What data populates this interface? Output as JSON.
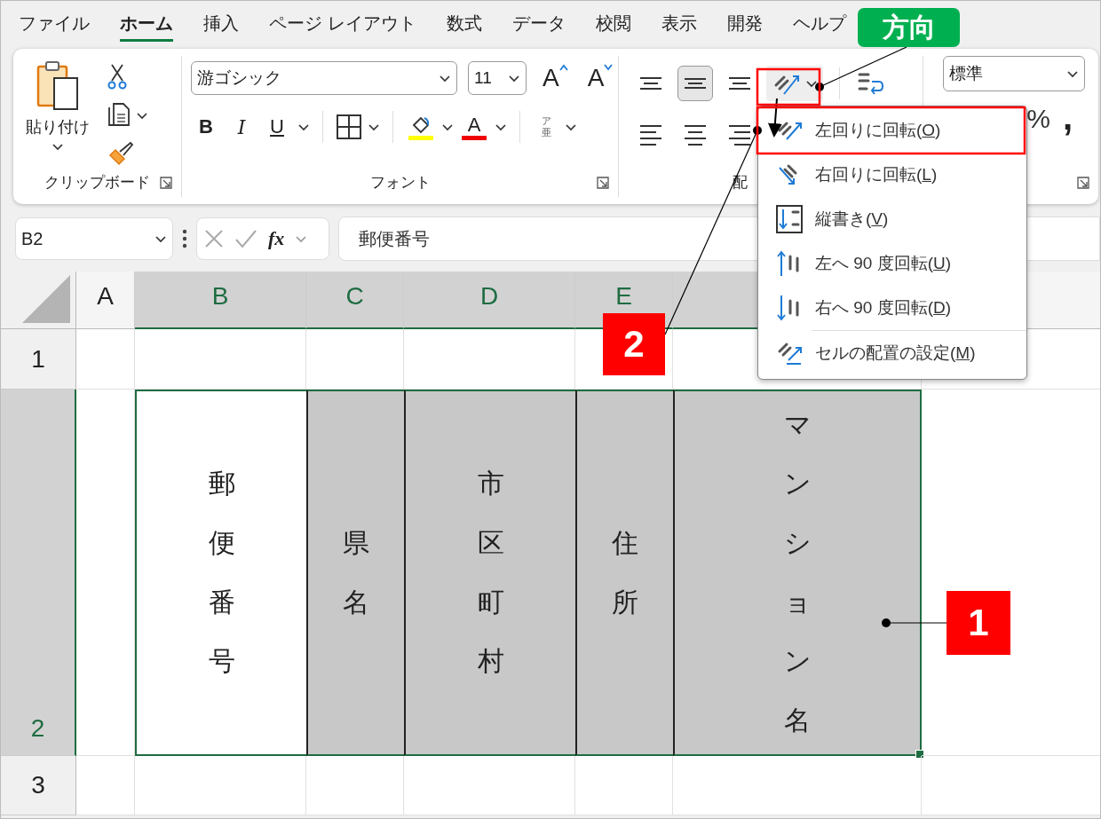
{
  "menu_tabs": [
    {
      "label": "ファイル",
      "selected": false
    },
    {
      "label": "ホーム",
      "selected": true
    },
    {
      "label": "挿入",
      "selected": false
    },
    {
      "label": "ページ レイアウト",
      "selected": false
    },
    {
      "label": "数式",
      "selected": false
    },
    {
      "label": "データ",
      "selected": false
    },
    {
      "label": "校閲",
      "selected": false
    },
    {
      "label": "表示",
      "selected": false
    },
    {
      "label": "開発",
      "selected": false
    },
    {
      "label": "ヘルプ",
      "selected": false
    }
  ],
  "ribbon": {
    "clipboard": {
      "paste": "貼り付け",
      "label": "クリップボード"
    },
    "font": {
      "font_name": "游ゴシック",
      "font_size": "11",
      "grow": "A",
      "shrink": "A",
      "bold": "B",
      "italic": "I",
      "underline": "U",
      "font_color": "A",
      "phonetic_top": "ア",
      "phonetic_bottom": "亜",
      "label": "フォント"
    },
    "alignment": {
      "buttons": [
        {
          "kind": "top",
          "selected": false
        },
        {
          "kind": "middle",
          "selected": true
        },
        {
          "kind": "bottom",
          "selected": false
        },
        {
          "kind": "left",
          "selected": false
        },
        {
          "kind": "center",
          "selected": false
        },
        {
          "kind": "right",
          "selected": false
        }
      ],
      "label": "配"
    },
    "number": {
      "format": "標準",
      "percent": "%",
      "comma": ","
    }
  },
  "formula_bar": {
    "name_box": "B2",
    "fx": "fx",
    "formula": "郵便番号"
  },
  "grid": {
    "columns": [
      {
        "label": "A",
        "selected": false
      },
      {
        "label": "B",
        "selected": true
      },
      {
        "label": "C",
        "selected": true
      },
      {
        "label": "D",
        "selected": true
      },
      {
        "label": "E",
        "selected": true
      },
      {
        "selected": true
      },
      {
        "selected": false
      }
    ],
    "rows": [
      {
        "label": "1",
        "selected": false,
        "cells": [
          {
            "selected": false
          },
          {
            "selected": false
          },
          {
            "selected": false
          },
          {
            "selected": false
          },
          {
            "selected": false
          },
          {
            "selected": false
          },
          {
            "selected": false
          }
        ]
      },
      {
        "label": "2",
        "selected": true,
        "cells": [
          {
            "selected": false
          },
          {
            "text": "郵便番号",
            "selected": true,
            "active": true
          },
          {
            "text": "県名",
            "selected": true,
            "active": false
          },
          {
            "text": "市区町村",
            "selected": true,
            "active": false
          },
          {
            "text": "住所",
            "selected": true,
            "active": false
          },
          {
            "text": "マンション名",
            "selected": true,
            "active": false
          },
          {
            "selected": false
          }
        ]
      },
      {
        "label": "3",
        "selected": false,
        "cells": [
          {
            "selected": false
          },
          {
            "selected": false
          },
          {
            "selected": false
          },
          {
            "selected": false
          },
          {
            "selected": false
          },
          {
            "selected": false
          },
          {
            "selected": false
          }
        ]
      }
    ]
  },
  "orientation_menu": [
    {
      "label": "左回りに回転(O)",
      "kind": "ccw",
      "divider_above": false
    },
    {
      "label": "右回りに回転(L)",
      "kind": "cw",
      "divider_above": false
    },
    {
      "label": "縦書き(V)",
      "kind": "vertical",
      "divider_above": false
    },
    {
      "label": "左へ 90 度回転(U)",
      "kind": "up",
      "divider_above": false
    },
    {
      "label": "右へ 90 度回転(D)",
      "kind": "down",
      "divider_above": false
    },
    {
      "label": "セルの配置の設定(M)",
      "kind": "format",
      "divider_above": true
    }
  ],
  "callouts": [
    {
      "text": "方向",
      "color": "#00b050"
    },
    {
      "text": "2",
      "color": "#ff0000"
    },
    {
      "text": "1",
      "color": "#ff0000"
    }
  ]
}
